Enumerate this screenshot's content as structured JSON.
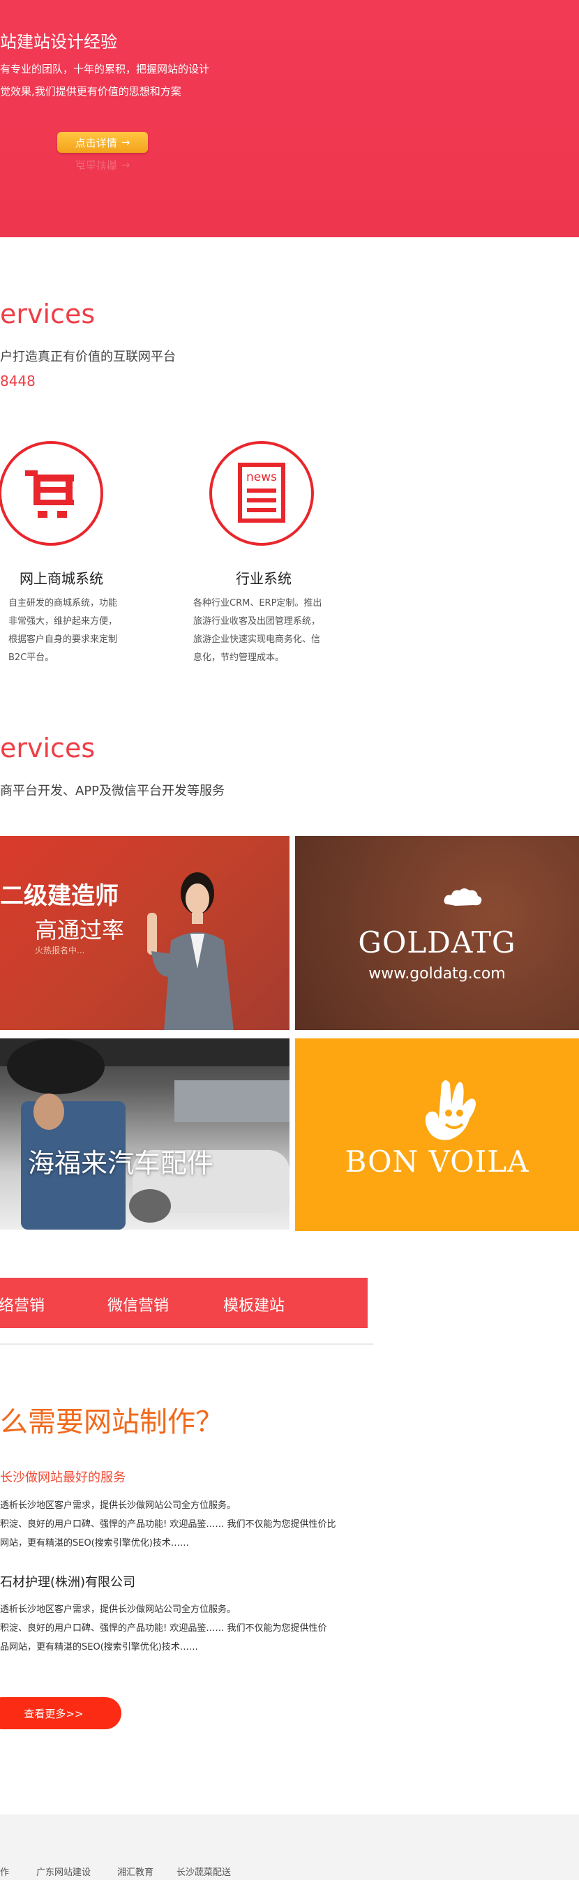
{
  "hero": {
    "subtitle": "站建站设计经验",
    "desc_line1": "有专业的团队，十年的累积，把握网站的设计",
    "desc_line2": "觉效果,我们提供更有价值的思想和方案",
    "detail_button": "点击详情",
    "detail_button_arrow": "→"
  },
  "services_section": {
    "title": "ervices",
    "subtitle": "户打造真正有价值的互联网平台",
    "phone": "8448"
  },
  "features": [
    {
      "icon": "shopping-cart-icon",
      "title": "网上商城系统",
      "desc": [
        "自主研发的商城系统，功能",
        "非常强大，维护起来方便，",
        "根据客户自身的要求来定制",
        "B2C平台。"
      ]
    },
    {
      "icon": "news-icon",
      "icon_label": "news",
      "title": "行业系统",
      "desc": [
        "各种行业CRM、ERP定制。推出",
        "旅游行业收客及出团管理系统，",
        "旅游企业快速实现电商务化、信",
        "息化，节约管理成本。"
      ]
    }
  ],
  "cases_section": {
    "title": "ervices",
    "subtitle": "商平台开发、APP及微信平台开发等服务"
  },
  "cases": [
    {
      "big": "二级建造师",
      "medium": "高通过率",
      "small": "火热报名中..."
    },
    {
      "logo": "GOLDATG",
      "url": "www.goldatg.com"
    },
    {
      "title": "海福来汽车配件"
    },
    {
      "brand": "BON VOILA"
    }
  ],
  "tabs": [
    "络营销",
    "微信营销",
    "模板建站"
  ],
  "qa": {
    "title": "么需要网站制作？",
    "items": [
      {
        "heading": "长沙做网站最好的服务",
        "lines": [
          "透析长沙地区客户需求，提供长沙做网站公司全方位服务。",
          "积淀、良好的用户口碑、强悍的产品功能! 欢迎品鉴…… 我们不仅能为您提供性价比",
          "网站，更有精湛的SEO(搜索引擎优化)技术……"
        ]
      },
      {
        "heading": "石材护理(株洲)有限公司",
        "lines": [
          "透析长沙地区客户需求，提供长沙做网站公司全方位服务。",
          "积淀、良好的用户口碑、强悍的产品功能! 欢迎品鉴…… 我们不仅能为您提供性价",
          "品网站，更有精湛的SEO(搜索引擎优化)技术……"
        ]
      }
    ],
    "more_button": "查看更多>>"
  },
  "footer": {
    "links": [
      "作",
      "广东网站建设",
      "湘汇教育",
      "长沙蔬菜配送"
    ]
  },
  "colors": {
    "hero_red": "#ef3a51",
    "accent_red": "#ef3e46",
    "orange": "#f06a1d",
    "button_yellow": "#f7b42a",
    "bonvoila_yellow": "#fda612"
  }
}
